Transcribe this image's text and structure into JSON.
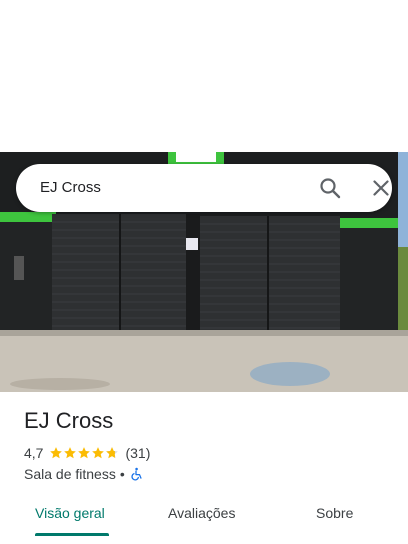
{
  "search": {
    "query": "EJ Cross",
    "search_icon": "search-icon",
    "close_icon": "close-icon"
  },
  "place": {
    "name": "EJ Cross",
    "rating": "4,7",
    "stars": 4.7,
    "review_count": "(31)",
    "category": "Sala de fitness",
    "separator": "•",
    "accessibility_icon": "wheelchair-icon"
  },
  "tabs": [
    {
      "label": "Visão geral",
      "active": true
    },
    {
      "label": "Avaliações",
      "active": false
    },
    {
      "label": "Sobre",
      "active": false
    }
  ],
  "colors": {
    "accent": "#00796b",
    "star": "#fbbc04",
    "accessibility": "#1a73e8",
    "building_green": "#3ec43e"
  }
}
